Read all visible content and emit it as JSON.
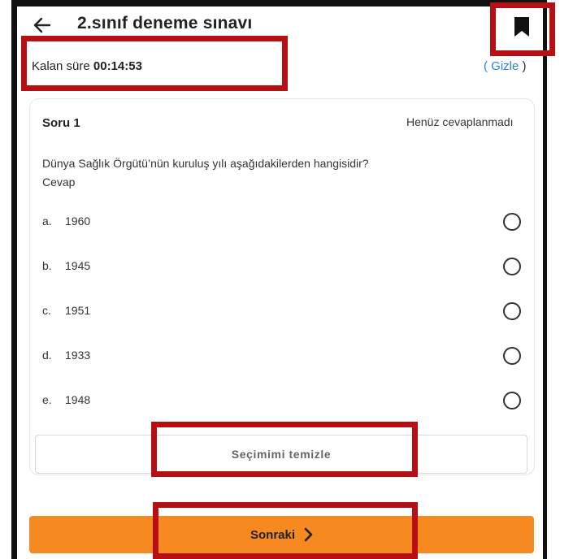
{
  "header": {
    "title": "2.sınıf deneme sınavı",
    "back_icon": "arrow-left-icon",
    "bookmark_icon": "bookmark-icon"
  },
  "timer": {
    "label": "Kalan süre",
    "value": "00:14:53"
  },
  "toggle": {
    "open_paren": "(",
    "label": "Gizle",
    "close_paren": ")"
  },
  "question": {
    "title": "Soru 1",
    "status": "Henüz cevaplanmadı",
    "text": "Dünya Sağlık Örgütü’nün kuruluş yılı aşağıdakilerden hangisidir?",
    "answer_label": "Cevap",
    "options": [
      {
        "letter": "a.",
        "value": "1960"
      },
      {
        "letter": "b.",
        "value": "1945"
      },
      {
        "letter": "c.",
        "value": "1951"
      },
      {
        "letter": "d.",
        "value": "1933"
      },
      {
        "letter": "e.",
        "value": "1948"
      }
    ]
  },
  "actions": {
    "clear_label": "Seçimimi temizle",
    "next_label": "Sonraki",
    "next_icon": "chevron-right-icon"
  },
  "colors": {
    "accent": "#f6891f",
    "link": "#2b84d6",
    "highlight": "#b80f14"
  }
}
